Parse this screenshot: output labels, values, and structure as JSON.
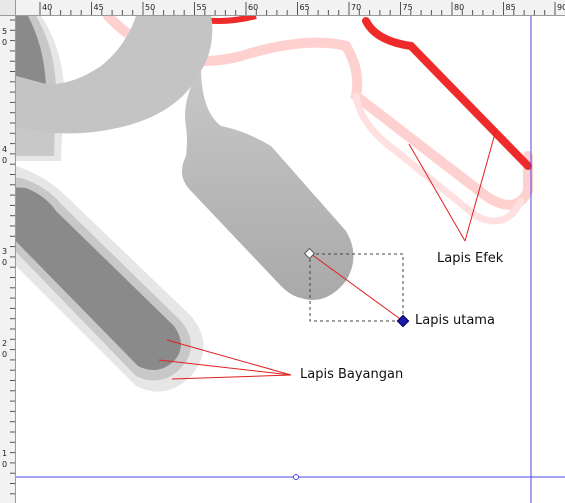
{
  "ruler": {
    "top_labels": [
      "40",
      "45",
      "50",
      "55",
      "60",
      "65",
      "70",
      "75",
      "80",
      "85",
      "90"
    ],
    "left_labels": [
      "5",
      "0",
      "4",
      "0",
      "3",
      "0",
      "2",
      "0",
      "1",
      "0"
    ]
  },
  "callouts": {
    "effect_layer": "Lapis Efek",
    "main_layer": "Lapis utama",
    "shadow_layer": "Lapis Bayangan"
  },
  "colors": {
    "canvas_bg": "#ffffff",
    "ruler_bg": "#f2f2f2",
    "guide": "#4a4ae0",
    "leader_line": "#e0201f",
    "effect_red": "#ef2a2a",
    "effect_pink": "#ffd0d0",
    "wrench_gray": "#c0c0c0",
    "shadow_dark": "#8a8a8a",
    "shadow_mid": "#c8c8c8",
    "shadow_light": "#e6e6e6",
    "handle_node": "#1a1aa8"
  },
  "icons": {
    "node_handle": "diamond-node-icon",
    "guide_origin": "guide-circle-icon"
  }
}
